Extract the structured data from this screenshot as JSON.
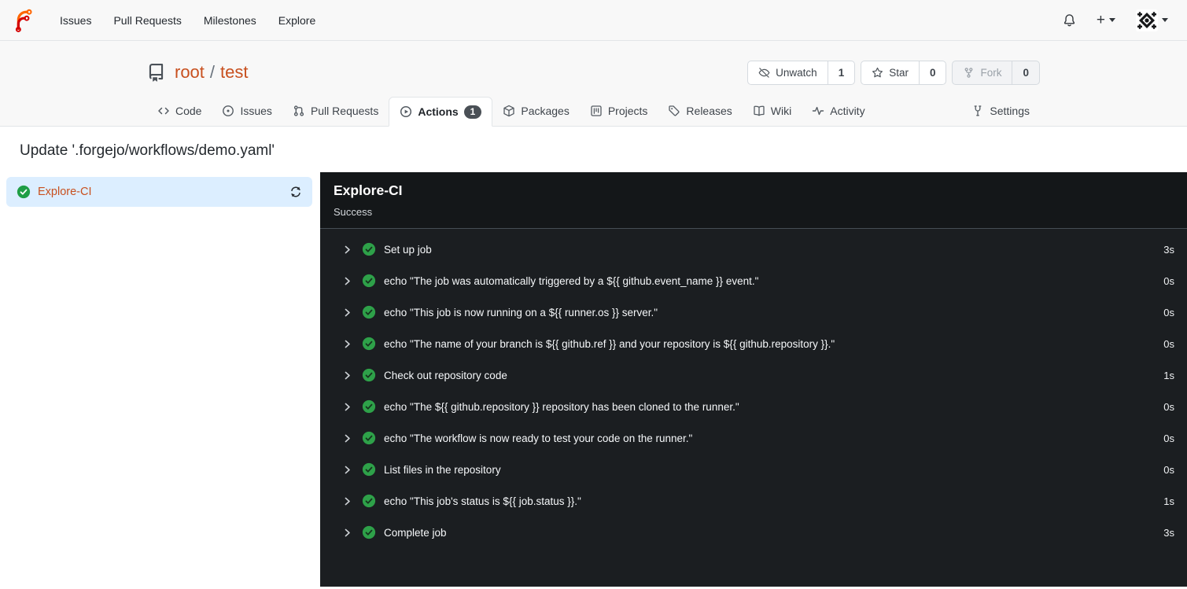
{
  "navbar": {
    "items": [
      "Issues",
      "Pull Requests",
      "Milestones",
      "Explore"
    ]
  },
  "repo": {
    "owner": "root",
    "separator": "/",
    "name": "test",
    "actions": {
      "unwatch_label": "Unwatch",
      "unwatch_count": "1",
      "star_label": "Star",
      "star_count": "0",
      "fork_label": "Fork",
      "fork_count": "0"
    },
    "tabs": {
      "code": "Code",
      "issues": "Issues",
      "pulls": "Pull Requests",
      "actions": "Actions",
      "actions_badge": "1",
      "packages": "Packages",
      "projects": "Projects",
      "releases": "Releases",
      "wiki": "Wiki",
      "activity": "Activity",
      "settings": "Settings"
    }
  },
  "run": {
    "title": "Update '.forgejo/workflows/demo.yaml'",
    "job_name": "Explore-CI"
  },
  "panel": {
    "title": "Explore-CI",
    "status": "Success",
    "steps": [
      {
        "label": "Set up job",
        "duration": "3s"
      },
      {
        "label": "echo \"The job was automatically triggered by a ${{ github.event_name }} event.\"",
        "duration": "0s"
      },
      {
        "label": "echo \"This job is now running on a ${{ runner.os }} server.\"",
        "duration": "0s"
      },
      {
        "label": "echo \"The name of your branch is ${{ github.ref }} and your repository is ${{ github.repository }}.\"",
        "duration": "0s"
      },
      {
        "label": "Check out repository code",
        "duration": "1s"
      },
      {
        "label": "echo \"The ${{ github.repository }} repository has been cloned to the runner.\"",
        "duration": "0s"
      },
      {
        "label": "echo \"The workflow is now ready to test your code on the runner.\"",
        "duration": "0s"
      },
      {
        "label": "List files in the repository",
        "duration": "0s"
      },
      {
        "label": "echo \"This job's status is ${{ job.status }}.\"",
        "duration": "1s"
      },
      {
        "label": "Complete job",
        "duration": "3s"
      }
    ]
  },
  "colors": {
    "primary_link": "#c8501f",
    "success_green": "#26a148",
    "selected_job_bg": "#dceeff",
    "panel_bg": "#1b1e21",
    "panel_header_bg": "#141719",
    "header_bg": "#f8f8f8"
  }
}
